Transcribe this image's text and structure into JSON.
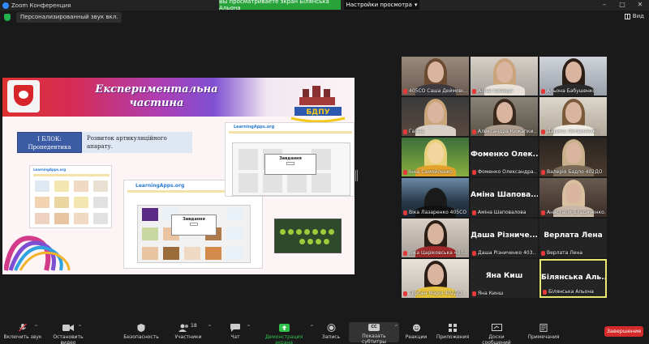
{
  "window": {
    "title": "Zoom Конференция",
    "viewing_banner": "Вы просматриваете экран Білянська Альона",
    "view_settings": "Настройки просмотра",
    "min": "–",
    "max": "□",
    "close": "✕"
  },
  "secondbar": {
    "audio_label": "Персонализированный звук вкл.",
    "view_label": "Вид"
  },
  "slide": {
    "title_line1": "Експериментальна",
    "title_line2": "частина",
    "uni_logo_text": "БДПУ",
    "block_label_1": "І БЛОК:",
    "block_label_2": "Пропедевтика",
    "block_desc_1": "Розвиток артикуляційного",
    "block_desc_2": "апарату.",
    "la_brand": "LearningApps.org",
    "dialog_title": "Завдання"
  },
  "participants": [
    {
      "name": "405СО Саша Деймові..."
    },
    {
      "name": "Аліна Синицл"
    },
    {
      "name": "Альона Бабушенко"
    },
    {
      "name": "Ганна"
    },
    {
      "name": "Александра Кижапки..."
    },
    {
      "name": "Дарина Литвиненко"
    },
    {
      "name": "Інна Самойленко"
    },
    {
      "name": "Фоменко Олександра...",
      "big": "Фоменко Олек..."
    },
    {
      "name": "Валерія Бадло 402ДО"
    },
    {
      "name": "Віка Лазаренко 405СО"
    },
    {
      "name": "Аміна Шаповалова",
      "big": "Аміна Шапова..."
    },
    {
      "name": "Анастасія Владиченко..."
    },
    {
      "name": "Віка Царіковська 403..."
    },
    {
      "name": "Даша Різниченко 403...",
      "big": "Даша Різниче..."
    },
    {
      "name": "Верлата Лена",
      "big": "Верлата Лена"
    },
    {
      "name": "Горбан Марія 402ДО..."
    },
    {
      "name": "Яна Кинш",
      "big": "Яна Киш"
    },
    {
      "name": "Білянська Альона",
      "big": "Білянська Аль..."
    }
  ],
  "toolbar": {
    "mute": "Включить звук",
    "stop_video": "Остановить видео",
    "security": "Безопасность",
    "participants": "Участники",
    "participants_count": "18",
    "chat": "Чат",
    "share_screen": "Демонстрация экрана",
    "record": "Запись",
    "subtitles": "Показать субтитры",
    "reactions": "Реакции",
    "apps": "Приложения",
    "whiteboards": "Доски сообщений",
    "notes": "Примечания",
    "end": "Завершение",
    "cc_icon": "CC"
  }
}
